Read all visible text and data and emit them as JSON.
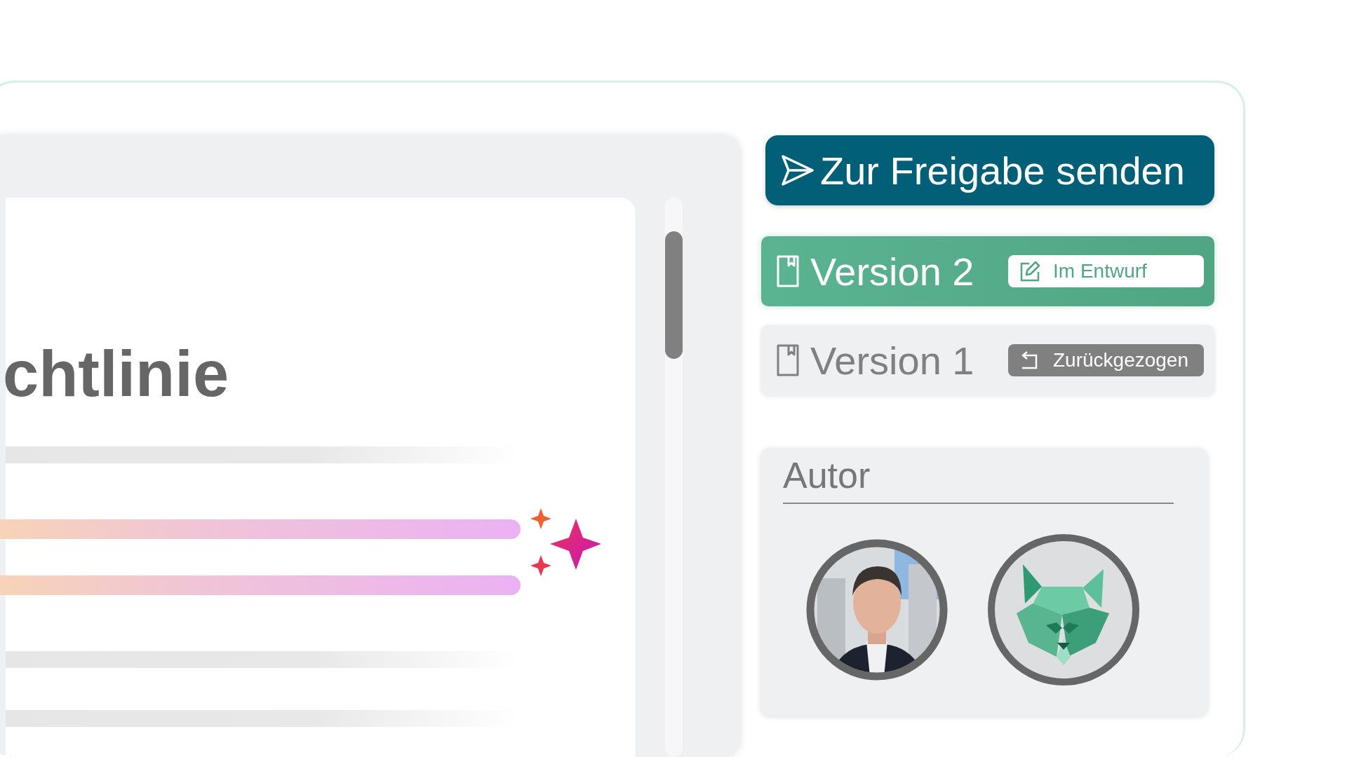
{
  "document": {
    "title": "chtlinie",
    "lines": [
      {
        "kind": "placeholder"
      },
      {
        "kind": "highlighted"
      },
      {
        "kind": "highlighted"
      },
      {
        "kind": "placeholder"
      },
      {
        "kind": "placeholder"
      }
    ]
  },
  "send_button": {
    "label": "Zur Freigabe senden"
  },
  "versions": [
    {
      "label": "Version 2",
      "selected": true,
      "status": {
        "kind": "draft",
        "label": "Im Entwurf"
      }
    },
    {
      "label": "Version 1",
      "selected": false,
      "status": {
        "kind": "withdrawn",
        "label": "Zurückgezogen"
      }
    }
  ],
  "author_panel": {
    "title": "Autor",
    "avatars": [
      {
        "kind": "picture"
      },
      {
        "kind": "logo"
      }
    ]
  }
}
